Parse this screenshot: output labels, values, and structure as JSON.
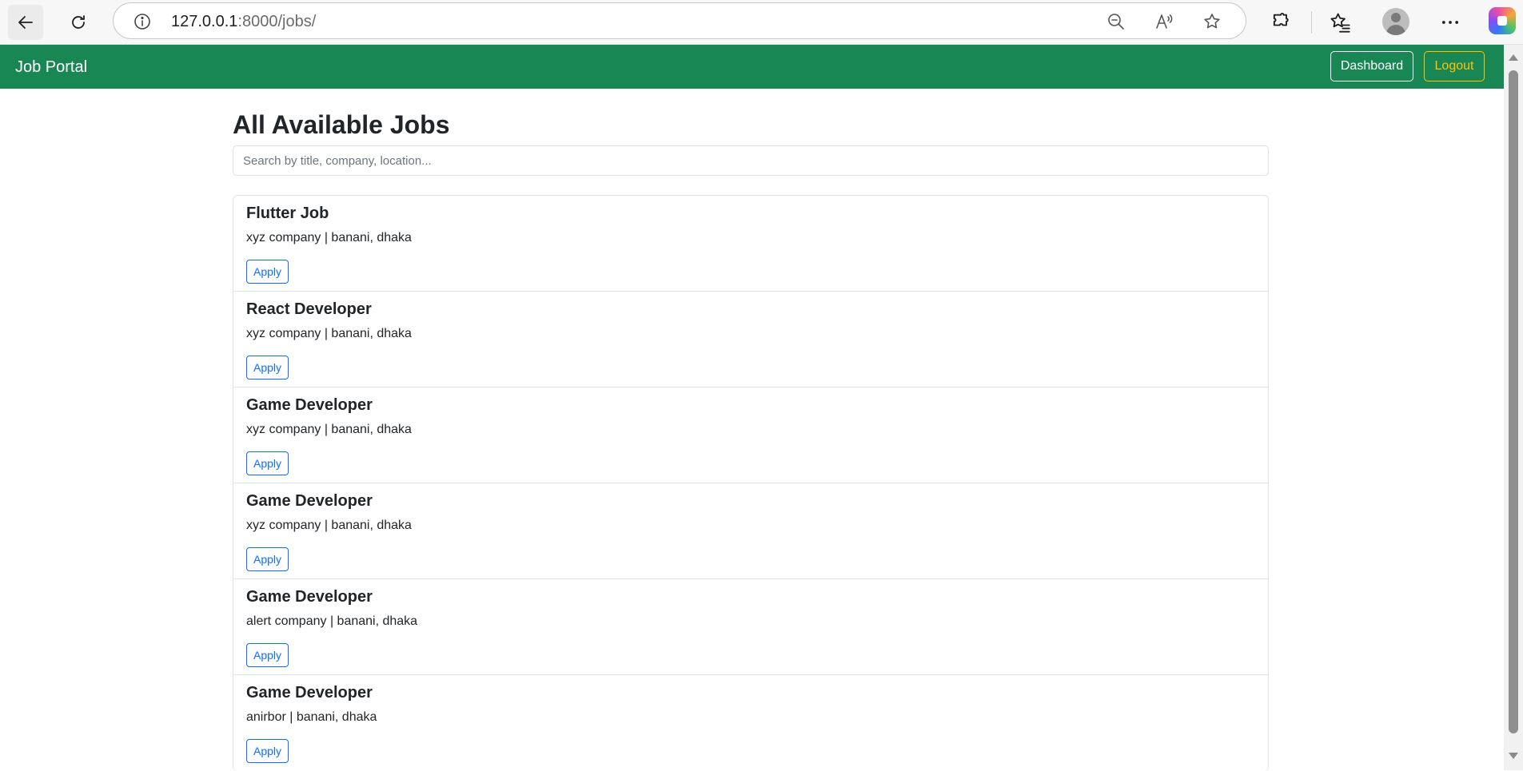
{
  "browser": {
    "url_host": "127.0.0.1",
    "url_rest": ":8000/jobs/",
    "icons": [
      "back-icon",
      "reload-icon",
      "info-icon",
      "zoom-out-icon",
      "read-aloud-icon",
      "star-icon",
      "extensions-icon",
      "favorites-icon",
      "profile-avatar",
      "more-icon",
      "copilot-icon"
    ]
  },
  "navbar": {
    "brand": "Job Portal",
    "dashboard_label": "Dashboard",
    "logout_label": "Logout",
    "colors": {
      "background": "#198754",
      "dashboard_border": "#ffffff",
      "logout_border": "#ffc107"
    }
  },
  "main": {
    "title": "All Available Jobs",
    "search_placeholder": "Search by title, company, location...",
    "apply_label": "Apply",
    "jobs": [
      {
        "title": "Flutter Job",
        "company": "xyz company",
        "location": "banani, dhaka",
        "meta": "xyz company | banani, dhaka"
      },
      {
        "title": "React Developer",
        "company": "xyz company",
        "location": "banani, dhaka",
        "meta": "xyz company | banani, dhaka"
      },
      {
        "title": "Game Developer",
        "company": "xyz company",
        "location": "banani, dhaka",
        "meta": "xyz company | banani, dhaka"
      },
      {
        "title": "Game Developer",
        "company": "xyz company",
        "location": "banani, dhaka",
        "meta": "xyz company | banani, dhaka"
      },
      {
        "title": "Game Developer",
        "company": "alert company",
        "location": "banani, dhaka",
        "meta": "alert company | banani, dhaka"
      },
      {
        "title": "Game Developer",
        "company": "anirbor",
        "location": "banani, dhaka",
        "meta": "anirbor | banani, dhaka"
      }
    ]
  }
}
